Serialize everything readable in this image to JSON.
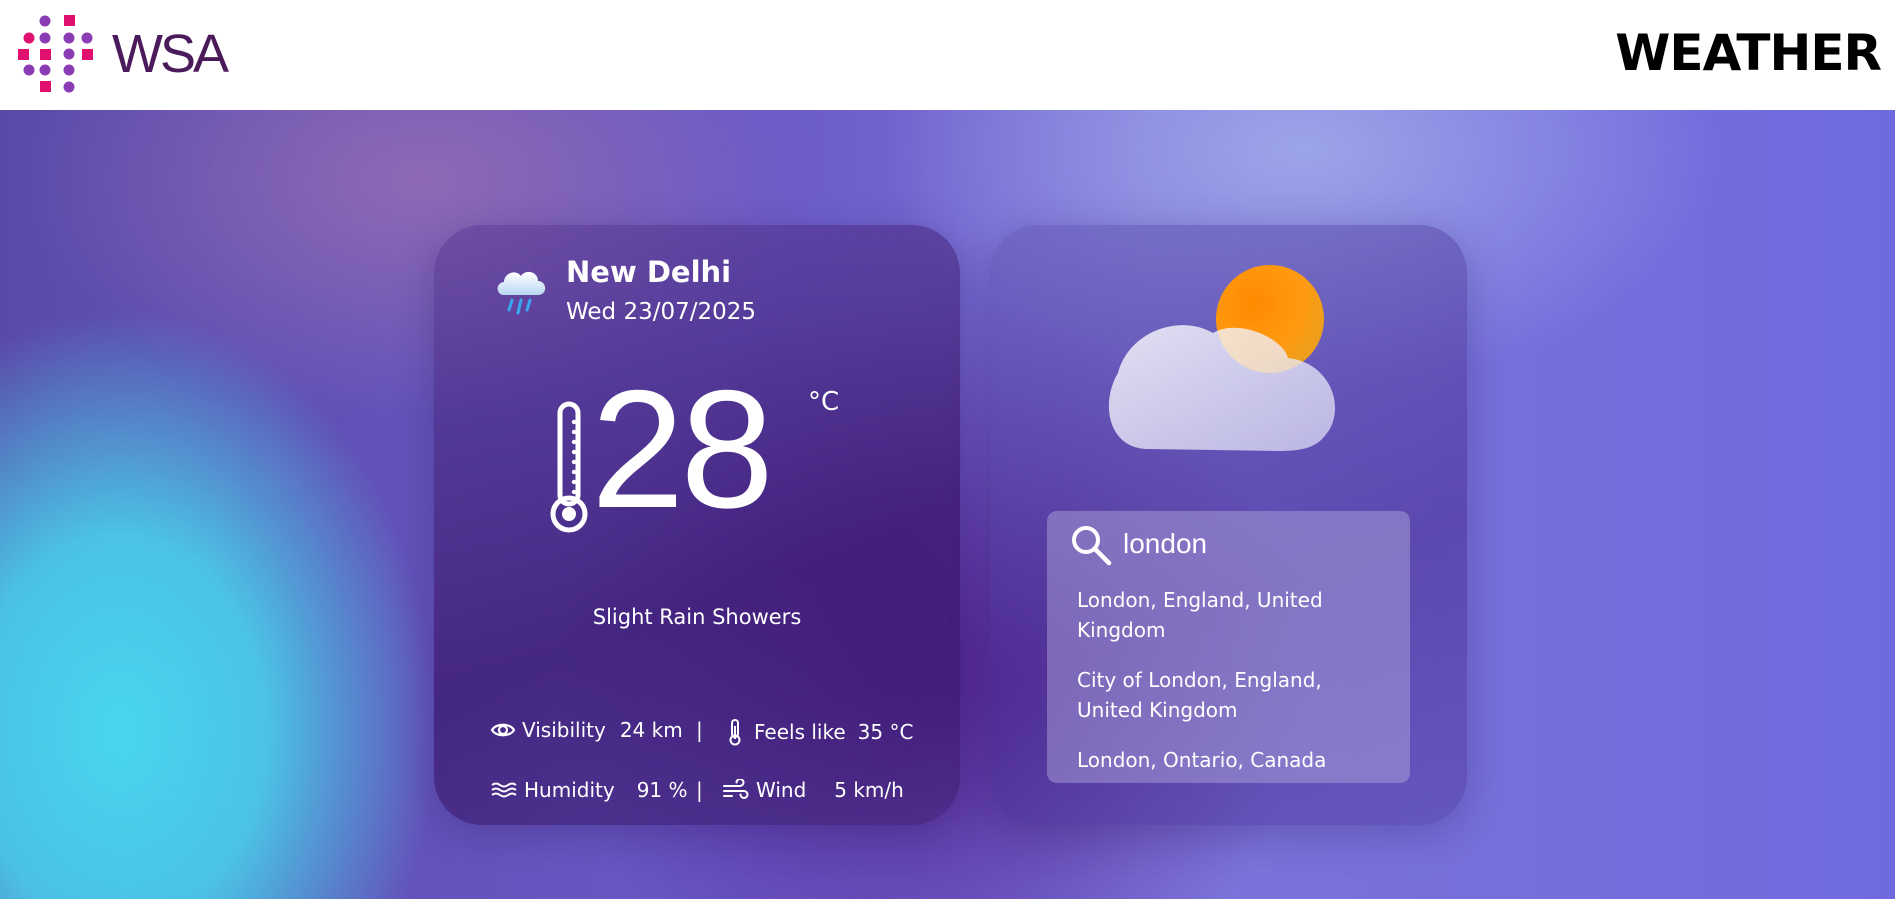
{
  "header": {
    "logo_text": "WSA",
    "title": "WEATHER"
  },
  "current": {
    "icon": "rain-cloud-icon",
    "city": "New Delhi",
    "date": "Wed 23/07/2025",
    "temperature": "28",
    "unit": "°C",
    "condition": "Slight Rain Showers",
    "visibility_label": "Visibility",
    "visibility_value": "24 km",
    "feels_like_label": "Feels like",
    "feels_like_value": "35 °C",
    "humidity_label": "Humidity",
    "humidity_value": "91 %",
    "wind_label": "Wind",
    "wind_value": "5 km/h",
    "separator": "|"
  },
  "search": {
    "value": "london",
    "icon": "search-icon",
    "results": [
      "London, England, United Kingdom",
      "City of London, England, United Kingdom",
      "London, Ontario, Canada"
    ]
  },
  "colors": {
    "logo_pink": "#e0106e",
    "logo_purple": "#8a3cb4",
    "logo_text": "#4a1a5a",
    "sun_orange": "#ff7a00",
    "cyan": "#48d6f0"
  }
}
